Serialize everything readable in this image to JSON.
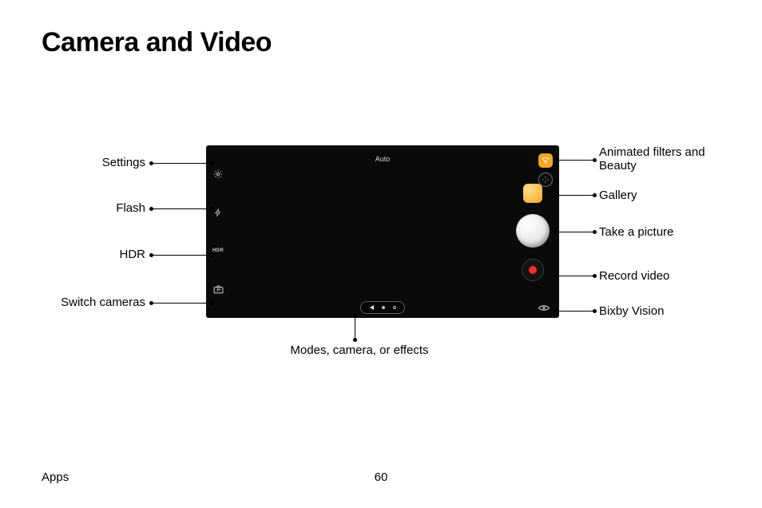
{
  "title": "Camera and Video",
  "camera": {
    "mode": "Auto",
    "left_strip": {
      "settings": "Settings",
      "flash": "Flash",
      "hdr": "HDR",
      "switch": "Switch cameras"
    }
  },
  "callouts": {
    "left": {
      "settings": "Settings",
      "flash": "Flash",
      "hdr": "HDR",
      "switch": "Switch cameras"
    },
    "bottom": "Modes, camera, or effects",
    "right": {
      "filters": "Animated filters and Beauty",
      "gallery": "Gallery",
      "shutter": "Take a picture",
      "record": "Record video",
      "bixby": "Bixby Vision"
    }
  },
  "footer": {
    "section": "Apps",
    "page": "60"
  }
}
